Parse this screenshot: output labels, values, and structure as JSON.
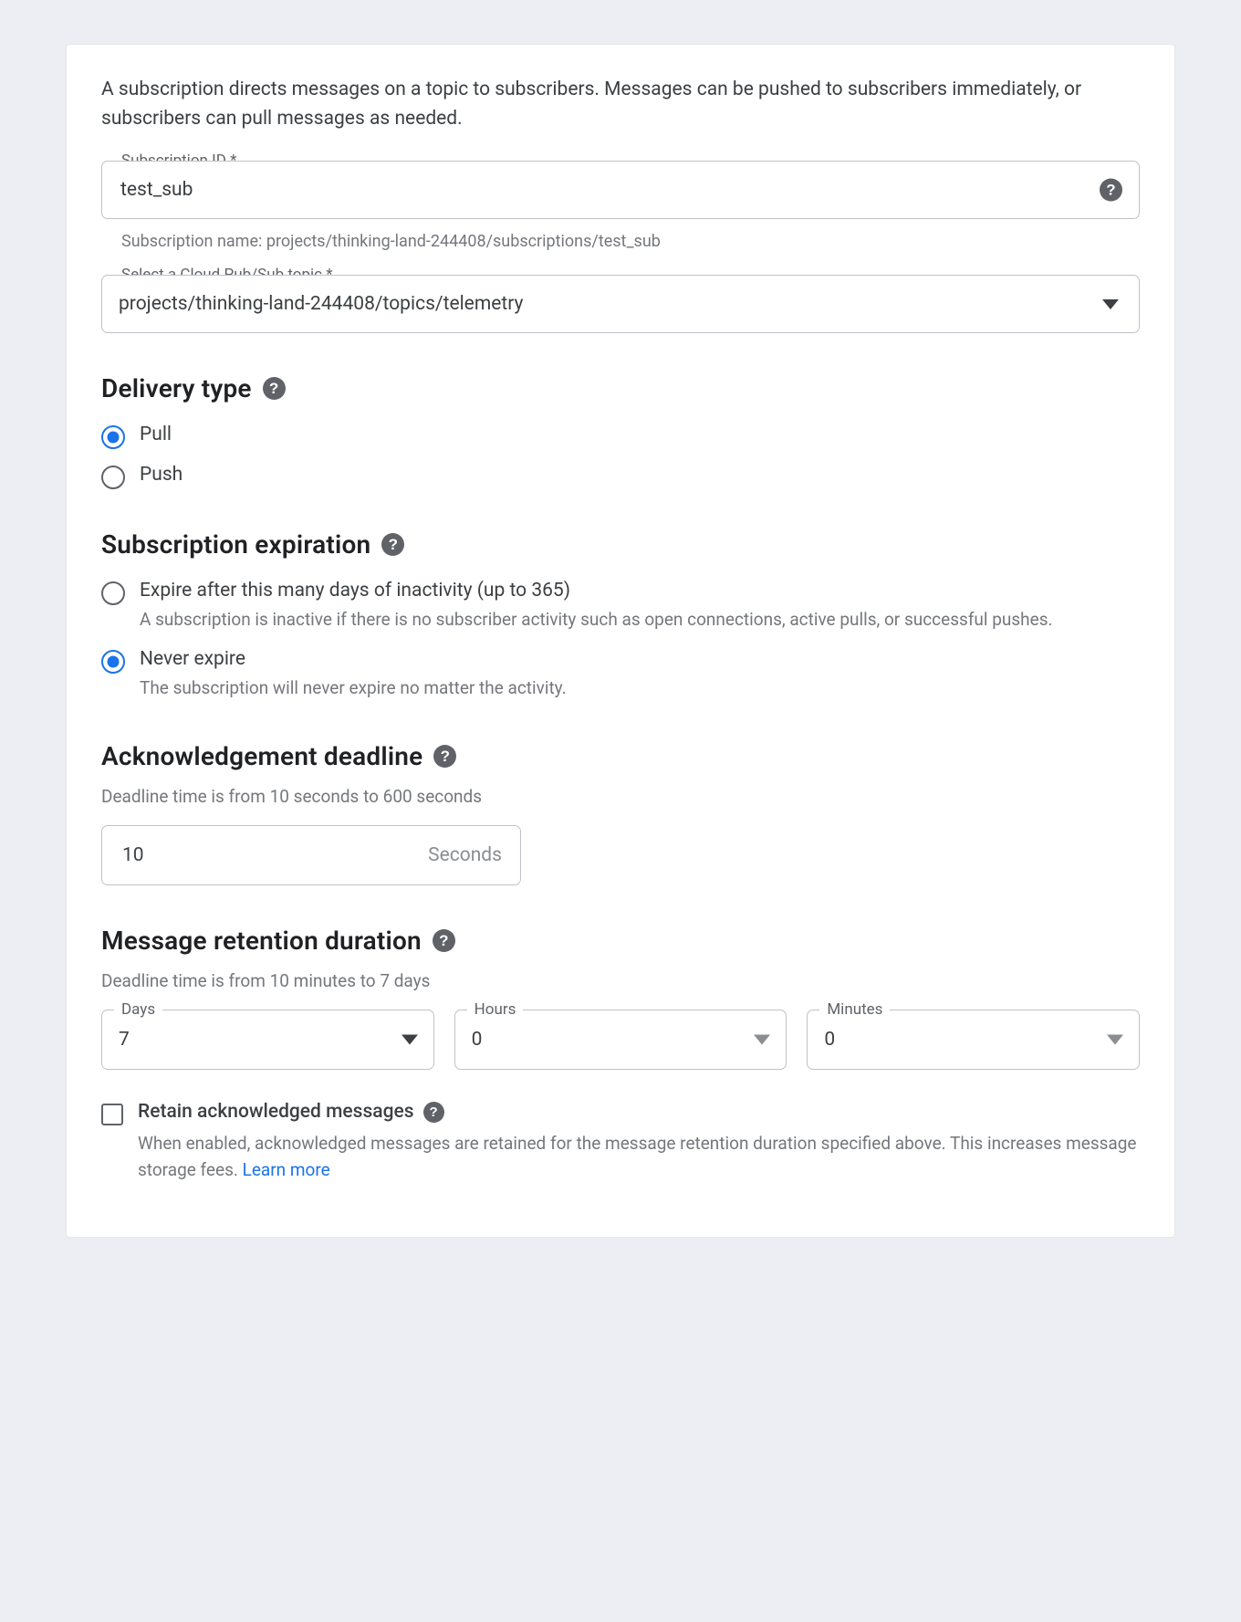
{
  "intro": "A subscription directs messages on a topic to subscribers. Messages can be pushed to subscribers immediately, or subscribers can pull messages as needed.",
  "sub_id": {
    "label": "Subscription ID *",
    "value": "test_sub",
    "hint_prefix": "Subscription name: ",
    "hint_value": "projects/thinking-land-244408/subscriptions/test_sub"
  },
  "topic": {
    "label": "Select a Cloud Pub/Sub topic *",
    "value": "projects/thinking-land-244408/topics/telemetry"
  },
  "delivery": {
    "heading": "Delivery type",
    "options": [
      {
        "label": "Pull",
        "selected": true
      },
      {
        "label": "Push",
        "selected": false
      }
    ]
  },
  "expiration": {
    "heading": "Subscription expiration",
    "options": [
      {
        "label": "Expire after this many days of inactivity (up to 365)",
        "desc": "A subscription is inactive if there is no subscriber activity such as open connections, active pulls, or successful pushes.",
        "selected": false
      },
      {
        "label": "Never expire",
        "desc": "The subscription will never expire no matter the activity.",
        "selected": true
      }
    ]
  },
  "ack": {
    "heading": "Acknowledgement deadline",
    "sub": "Deadline time is from 10 seconds to 600 seconds",
    "value": "10",
    "unit": "Seconds"
  },
  "retention": {
    "heading": "Message retention duration",
    "sub": "Deadline time is from 10 minutes to 7 days",
    "days": {
      "label": "Days",
      "value": "7"
    },
    "hours": {
      "label": "Hours",
      "value": "0"
    },
    "minutes": {
      "label": "Minutes",
      "value": "0"
    }
  },
  "retain": {
    "label": "Retain acknowledged messages",
    "desc_prefix": "When enabled, acknowledged messages are retained for the message retention duration specified above. This increases message storage fees. ",
    "link": "Learn more",
    "checked": false
  }
}
